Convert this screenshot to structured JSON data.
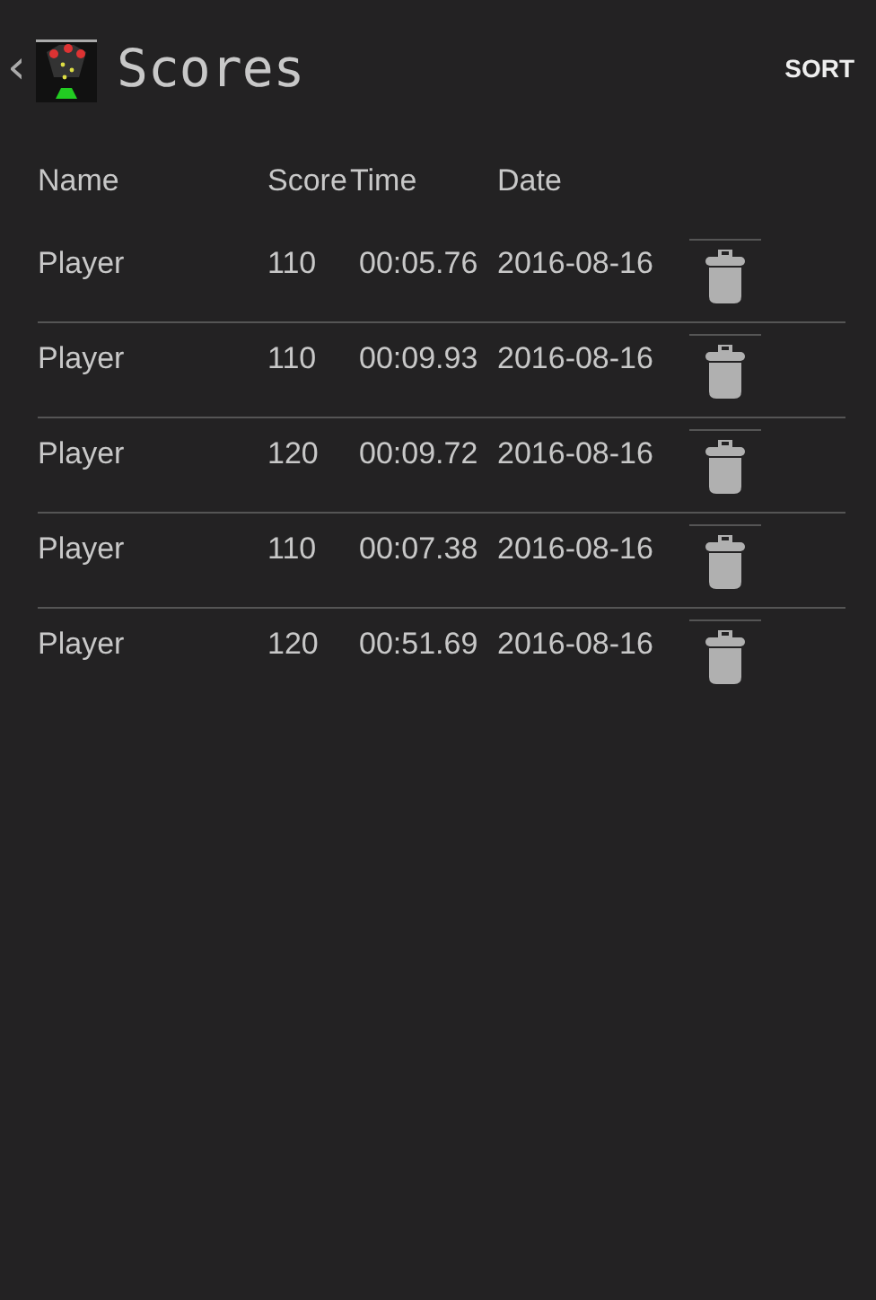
{
  "action_bar": {
    "back": "‹",
    "title": "Scores",
    "action": "SORT"
  },
  "table": {
    "columns": [
      "Name",
      "Score",
      "Time",
      "Date"
    ],
    "rows": [
      {
        "name": "Player",
        "score": "110",
        "time": "00:05.76",
        "date": "2016-08-16"
      },
      {
        "name": "Player",
        "score": "110",
        "time": "00:09.93",
        "date": "2016-08-16"
      },
      {
        "name": "Player",
        "score": "120",
        "time": "00:09.72",
        "date": "2016-08-16"
      },
      {
        "name": "Player",
        "score": "110",
        "time": "00:07.38",
        "date": "2016-08-16"
      },
      {
        "name": "Player",
        "score": "120",
        "time": "00:51.69",
        "date": "2016-08-16"
      }
    ]
  }
}
